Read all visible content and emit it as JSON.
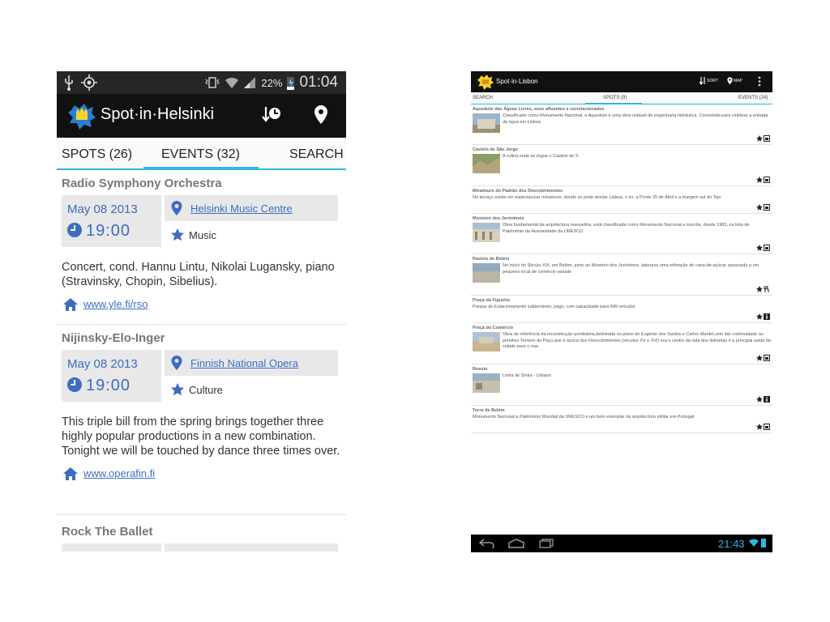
{
  "phone": {
    "status": {
      "battery": "22%",
      "time": "01:04"
    },
    "app_title": "Spot·in·Helsinki",
    "tabs": [
      "SPOTS (26)",
      "EVENTS (32)",
      "SEARCH"
    ],
    "events": [
      {
        "title": "Radio Symphony Orchestra",
        "date": "May 08 2013",
        "time": "19:00",
        "venue": "Helsinki Music Centre",
        "category": "Music",
        "description": "Concert, cond. Hannu Lintu, Nikolai Lugansky, piano (Stravinsky, Chopin, Sibelius).",
        "link": "www.yle.fi/rso"
      },
      {
        "title": "Nijinsky-Elo-Inger",
        "date": "May 08 2013",
        "time": "19:00",
        "venue": "Finnish National Opera",
        "category": "Culture",
        "description": "This triple bill from the spring brings together three highly popular productions in a new combination. Tonight we will be touched by dance three times over.",
        "link": "www.operafin.fi"
      },
      {
        "title": "Rock The Ballet"
      }
    ]
  },
  "tablet": {
    "app_title": "Spot·in·Lisbon",
    "sort_label": "SORT",
    "map_label": "MAP",
    "tabs": [
      "SEARCH",
      "SPOTS (9)",
      "EVENTS (24)"
    ],
    "spots": [
      {
        "name": "Aqueduto das Águas Livres, seus afluentes e correlacionados",
        "desc": "Classificado como Monumento Nacional, o Aqueduto é uma obra notável de engenharia hidráulica. Concebida para celebrar a entrada da água em Lisboa"
      },
      {
        "name": "Castelo de São Jorge",
        "desc": "A colina onde se ergue o Castelo de S"
      },
      {
        "name": "Miradouro do Padrão dos Descobrimentos",
        "desc": "No terraço existe um espectacular miradouro, donde se pode avistar Lisboa, o rio, a Ponte 25 de Abril e a margem sul do Tejo"
      },
      {
        "name": "Mosteiro dos Jerónimos",
        "desc": "Obra fundamental da arquitectura manuelina, está classificada como Monumento Nacional e inscrita, desde 1983, na lista de Património da Humanidade da UNESCO"
      },
      {
        "name": "Pastéis de Belém",
        "desc": "No início do Século XIX, em Belém, junto ao Mosteiro dos Jerónimos, laborava uma refinação de cana-de-açúcar associada a um pequeno local de comércio variado"
      },
      {
        "name": "Praça da Figueira",
        "desc": "Parque de Estacionamento subterrâneo, pago, com capacidade para 499 veículos"
      },
      {
        "name": "Praça do Comércio",
        "desc": "Obra de referência da reconstrução pombalina,delineada no plano de Eugénio dos Santos e Carlos Mardel,veio dar continuidade ao primitivo Terreiro do Paço,que à época dos Descobrimentos (séculos XV e XVI) era o centro da vida dos lisboetas e a principal saída da cidade para o mar"
      },
      {
        "name": "Rossio",
        "desc": "Linha de Sintra - Urbano"
      },
      {
        "name": "Torre de Belém",
        "desc": "Monumento Nacional e Património Mundial da UNESCO e um belo exemplar da arquitectura militar em Portugal"
      }
    ],
    "nav_time": "21:43"
  },
  "colors": {
    "accent": "#33b5e5",
    "link": "#3d6cc1",
    "actionbar": "#111111"
  }
}
